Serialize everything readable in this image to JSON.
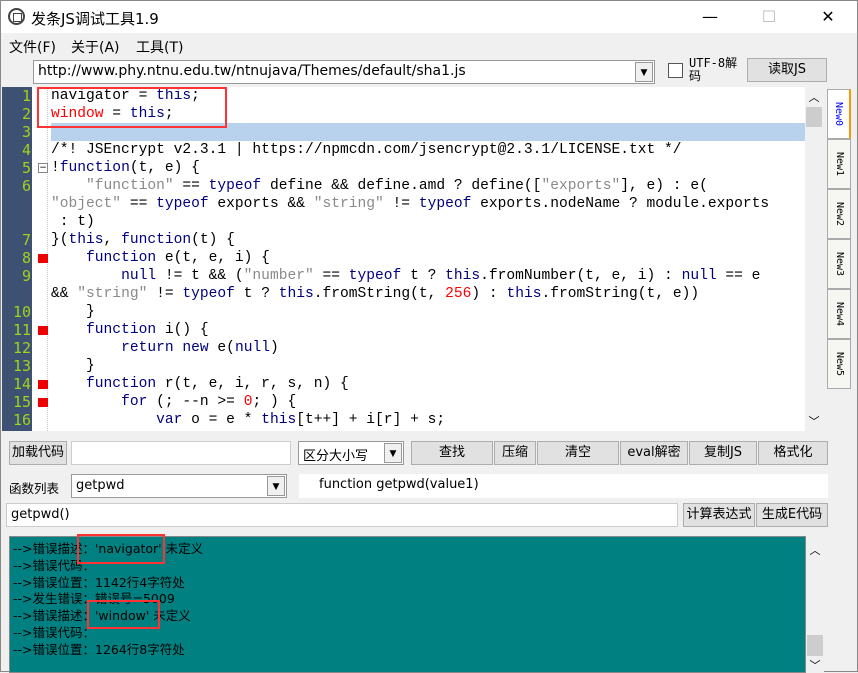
{
  "window": {
    "title": "发条JS调试工具1.9",
    "minimize": "—",
    "maximize": "☐",
    "close": "✕"
  },
  "menu": [
    "文件(F)",
    "关于(A)",
    "工具(T)"
  ],
  "url_bar": {
    "value": "http://www.phy.ntnu.edu.tw/ntnujava/Themes/default/sha1.js",
    "utf8_label": "UTF-8解码",
    "utf8_checked": false,
    "read_button": "读取JS"
  },
  "editor": {
    "lines": [
      {
        "n": "1",
        "fold": "",
        "tokens": [
          [
            "navigator",
            "tx"
          ],
          [
            " = ",
            "tx"
          ],
          [
            "this",
            "kw"
          ],
          [
            ";",
            "tx"
          ]
        ]
      },
      {
        "n": "2",
        "fold": "",
        "tokens": [
          [
            "window",
            "red"
          ],
          [
            " = ",
            "tx"
          ],
          [
            "this",
            "kw"
          ],
          [
            ";",
            "tx"
          ]
        ]
      },
      {
        "n": "3",
        "fold": "",
        "tokens": []
      },
      {
        "n": "4",
        "fold": "",
        "tokens": [
          [
            "/*! JSEncrypt v2.3.1 | https://npmcdn.com/jsencrypt@2.3.1/LICENSE.txt */",
            "tx"
          ]
        ]
      },
      {
        "n": "5",
        "fold": "box",
        "tokens": [
          [
            "!",
            "tx"
          ],
          [
            "function",
            "kw"
          ],
          [
            "(t, e) {",
            "tx"
          ]
        ]
      },
      {
        "n": "6",
        "fold": "",
        "tokens": [
          [
            "    ",
            "tx"
          ],
          [
            "\"function\"",
            "st"
          ],
          [
            " == ",
            "tx"
          ],
          [
            "typeof",
            "kw"
          ],
          [
            " define && define.amd ? define([",
            "tx"
          ],
          [
            "\"exports\"",
            "st"
          ],
          [
            "], e) : e(",
            "tx"
          ]
        ]
      },
      {
        "n": "",
        "fold": "",
        "tokens": [
          [
            "\"object\"",
            "st"
          ],
          [
            " == ",
            "tx"
          ],
          [
            "typeof",
            "kw"
          ],
          [
            " exports && ",
            "tx"
          ],
          [
            "\"string\"",
            "st"
          ],
          [
            " != ",
            "tx"
          ],
          [
            "typeof",
            "kw"
          ],
          [
            " exports.nodeName ? module.exports",
            "tx"
          ]
        ]
      },
      {
        "n": "",
        "fold": "",
        "tokens": [
          [
            " : t)",
            "tx"
          ]
        ]
      },
      {
        "n": "7",
        "fold": "",
        "tokens": [
          [
            "}(",
            "tx"
          ],
          [
            "this",
            "kw"
          ],
          [
            ", ",
            "tx"
          ],
          [
            "function",
            "kw"
          ],
          [
            "(t) {",
            "tx"
          ]
        ]
      },
      {
        "n": "8",
        "fold": "red",
        "tokens": [
          [
            "    ",
            "tx"
          ],
          [
            "function",
            "kw"
          ],
          [
            " e(t, e, i) {",
            "tx"
          ]
        ]
      },
      {
        "n": "9",
        "fold": "",
        "tokens": [
          [
            "        ",
            "tx"
          ],
          [
            "null",
            "kw"
          ],
          [
            " != t && (",
            "tx"
          ],
          [
            "\"number\"",
            "st"
          ],
          [
            " == ",
            "tx"
          ],
          [
            "typeof",
            "kw"
          ],
          [
            " t ? ",
            "tx"
          ],
          [
            "this",
            "kw"
          ],
          [
            ".fromNumber(t, e, i) : ",
            "tx"
          ],
          [
            "null",
            "kw"
          ],
          [
            " == e",
            "tx"
          ]
        ]
      },
      {
        "n": "",
        "fold": "",
        "tokens": [
          [
            "&& ",
            "tx"
          ],
          [
            "\"string\"",
            "st"
          ],
          [
            " != ",
            "tx"
          ],
          [
            "typeof",
            "kw"
          ],
          [
            " t ? ",
            "tx"
          ],
          [
            "this",
            "kw"
          ],
          [
            ".fromString(t, ",
            "tx"
          ],
          [
            "256",
            "nu"
          ],
          [
            ") : ",
            "tx"
          ],
          [
            "this",
            "kw"
          ],
          [
            ".fromString(t, e))",
            "tx"
          ]
        ]
      },
      {
        "n": "10",
        "fold": "",
        "tokens": [
          [
            "    }",
            "tx"
          ]
        ]
      },
      {
        "n": "11",
        "fold": "red",
        "tokens": [
          [
            "    ",
            "tx"
          ],
          [
            "function",
            "kw"
          ],
          [
            " i() {",
            "tx"
          ]
        ]
      },
      {
        "n": "12",
        "fold": "",
        "tokens": [
          [
            "        ",
            "tx"
          ],
          [
            "return",
            "kw"
          ],
          [
            " ",
            "tx"
          ],
          [
            "new",
            "kw"
          ],
          [
            " e(",
            "tx"
          ],
          [
            "null",
            "kw"
          ],
          [
            ")",
            "tx"
          ]
        ]
      },
      {
        "n": "13",
        "fold": "",
        "tokens": [
          [
            "    }",
            "tx"
          ]
        ]
      },
      {
        "n": "14",
        "fold": "red",
        "tokens": [
          [
            "    ",
            "tx"
          ],
          [
            "function",
            "kw"
          ],
          [
            " r(t, e, i, r, s, n) {",
            "tx"
          ]
        ]
      },
      {
        "n": "15",
        "fold": "red",
        "tokens": [
          [
            "        ",
            "tx"
          ],
          [
            "for",
            "kw"
          ],
          [
            " (; --n >= ",
            "tx"
          ],
          [
            "0",
            "nu"
          ],
          [
            "; ) {",
            "tx"
          ]
        ]
      },
      {
        "n": "16",
        "fold": "",
        "tokens": [
          [
            "            ",
            "tx"
          ],
          [
            "var",
            "kw"
          ],
          [
            " o = e * ",
            "tx"
          ],
          [
            "this",
            "kw"
          ],
          [
            "[t++] + i[r] + s;",
            "tx"
          ]
        ]
      }
    ]
  },
  "tabs": [
    "New0",
    "New1",
    "New2",
    "New3",
    "New4",
    "New5"
  ],
  "active_tab": "New0",
  "toolbar": {
    "load_button": "加载代码",
    "search_value": "",
    "case_select": "区分大小写",
    "find": "查找",
    "compress": "压缩",
    "clear": "清空",
    "eval_decrypt": "eval解密",
    "copy_js": "复制JS",
    "format": "格式化"
  },
  "functions": {
    "label": "函数列表",
    "selected": "getpwd",
    "signature": "function getpwd(value1)"
  },
  "expression": {
    "value": "getpwd()",
    "calc_button": "计算表达式",
    "gen_button": "生成E代码"
  },
  "output": [
    "-->错误描述：'navigator' 未定义",
    "-->错误代码：",
    "-->错误位置：1142行4字符处",
    "-->发生错误：错误号=5009",
    "-->错误描述：'window' 未定义",
    "-->错误代码：",
    "-->错误位置：1264行8字符处"
  ],
  "colors": {
    "output_bg": "#008080",
    "gutter_bg": "#3f5173",
    "line_number": "#9bd41c",
    "keyword": "#00007f",
    "string": "#8a8a8a",
    "number": "#ff0000",
    "highlight": "#ff3333"
  }
}
